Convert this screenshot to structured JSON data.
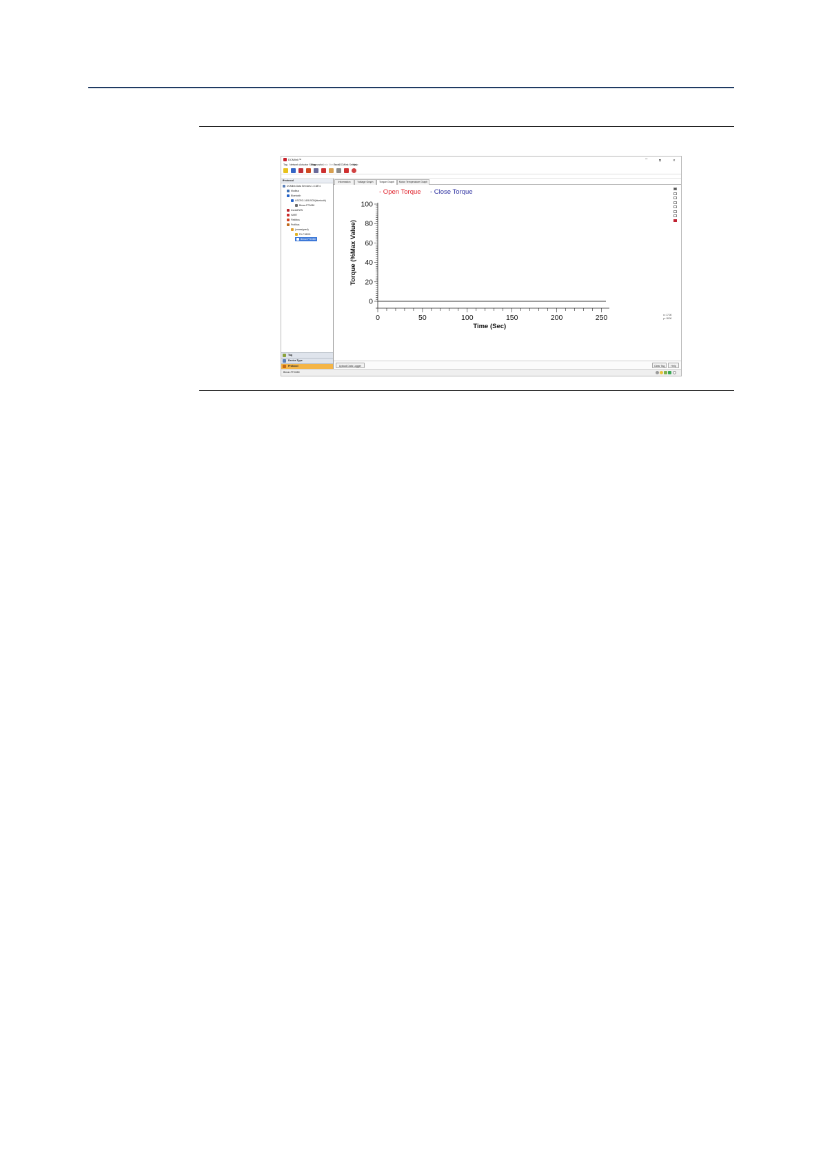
{
  "window": {
    "title": "DCMlink™",
    "minimize_glyph": "–",
    "restore_glyph": "⧉",
    "close_glyph": "✕"
  },
  "menu": [
    "Tag",
    "Network",
    "Actuator Setup",
    "Diagnostics",
    "Data Stream",
    "Tools",
    "DCMlink Setup",
    "Help"
  ],
  "menu_disabled": [
    "Data Stream"
  ],
  "toolbar_icons": [
    "connect-icon",
    "save-icon",
    "actuator-icon",
    "pen-icon",
    "report-icon",
    "user-icon",
    "search-icon",
    "chat-icon",
    "run-icon",
    "stop-icon"
  ],
  "left_pane": {
    "header": "Protocol",
    "close_glyph": "×",
    "tree": [
      {
        "label": "DCMlink Data Services 1.0.3874",
        "indent": 0,
        "icon": "network-icon",
        "color": "#5a7fb8"
      },
      {
        "label": "Modbus",
        "indent": 1,
        "icon": "modbus-icon",
        "color": "#3b6fb5"
      },
      {
        "label": "Bluetooth",
        "indent": 1,
        "icon": "bluetooth-icon",
        "color": "#2463c8"
      },
      {
        "label": "USCRO-1408-9CB(bluetooth)",
        "indent": 2,
        "icon": "bluetooth-device-icon",
        "color": "#2463c8"
      },
      {
        "label": "Bimar-FTD080",
        "indent": 3,
        "icon": "device-icon",
        "color": "#6a6a6a"
      },
      {
        "label": "IecrabRZW",
        "indent": 1,
        "icon": "iec-icon",
        "color": "#b9252c"
      },
      {
        "label": "HART",
        "indent": 1,
        "icon": "hart-icon",
        "color": "#cc2b2b"
      },
      {
        "label": "Fieldbus",
        "indent": 1,
        "icon": "fieldbus-icon",
        "color": "#d04020"
      },
      {
        "label": "Profibus",
        "indent": 1,
        "icon": "profibus-icon",
        "color": "#c06a1c"
      },
      {
        "label": "(unassigned)",
        "indent": 2,
        "icon": "folder-icon",
        "color": "#e0a030"
      },
      {
        "label": "Pri-F18001",
        "indent": 3,
        "icon": "actuator-node-icon",
        "color": "#e0b020"
      },
      {
        "label": "Bimar-FTD080",
        "indent": 3,
        "icon": "selected-node-icon",
        "color": "#3d78d8",
        "selected": true
      }
    ],
    "bottom_nav": [
      {
        "label": "Tag",
        "icon": "tag-icon",
        "color": "#8aa23a"
      },
      {
        "label": "Device Type",
        "icon": "device-type-icon",
        "color": "#5a7fb8"
      },
      {
        "label": "Protocol",
        "icon": "protocol-icon",
        "color": "#c66a12",
        "active": true
      }
    ]
  },
  "tabs": [
    {
      "label": "Information",
      "active": false
    },
    {
      "label": "Voltage Graph",
      "active": false
    },
    {
      "label": "Torque Graph",
      "active": true
    },
    {
      "label": "Motor Temperature Graph",
      "active": false
    }
  ],
  "side_icons": [
    "grid-icon",
    "draw-icon",
    "chart-icon",
    "zoom-in-icon",
    "zoom-out-icon",
    "zoom-fit-icon",
    "dots-icon",
    "color-icon"
  ],
  "readout": {
    "x": "x= 17.00",
    "y": "y= 18.00"
  },
  "buttons": {
    "upload": "Upload Data Logger",
    "clear": "Clear Tag",
    "help": "Help"
  },
  "status": {
    "text": "Bimar-FTD080"
  },
  "colors": {
    "open": "#e0202a",
    "close": "#2b2fa0",
    "selection": "#3d78d8",
    "active_nav": "#f4b547"
  },
  "chart_data": {
    "type": "line",
    "title": "",
    "xlabel": "Time (Sec)",
    "ylabel": "Torque (%Max Value)",
    "xlim": [
      0,
      255
    ],
    "ylim": [
      0,
      100
    ],
    "xticks": [
      0,
      50,
      100,
      150,
      200,
      250
    ],
    "yticks": [
      0,
      20,
      40,
      60,
      80,
      100
    ],
    "legend_position": "top",
    "grid": false,
    "series": [
      {
        "name": "Open Torque",
        "color": "#e0202a",
        "x": [
          0,
          255
        ],
        "y": [
          0,
          0
        ]
      },
      {
        "name": "Close Torque",
        "color": "#2b2fa0",
        "x": [
          0,
          255
        ],
        "y": [
          0,
          0
        ]
      }
    ]
  }
}
